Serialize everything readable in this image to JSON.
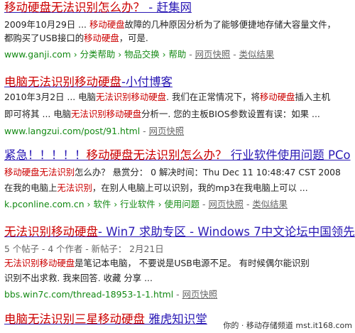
{
  "results": [
    {
      "title_pre": "移动硬盘无法识别怎么办？",
      "title_post": " - 赶集网",
      "snippet1_a": "2009年10月29日 ... ",
      "snippet1_b": "移动硬盘",
      "snippet1_c": "故障的几种原因分析为了能够便捷地存储大容量文件，",
      "snippet2": "都购买了USB接口的",
      "snippet2_b": "移动硬盘",
      "snippet2_c": "，可是.",
      "url": "www.ganji.com",
      "crumbs": [
        "分类帮助",
        "物品交换",
        "帮助"
      ],
      "cache": "网页快照",
      "similar": "类似结果"
    },
    {
      "title_pre": "电脑无法识别移动硬盘",
      "title_post": "-小付博客",
      "snippet1_a": "2010年3月2日 ... 电脑",
      "snippet1_b": "无法识别移动硬盘",
      "snippet1_c": ". 我们在正常情况下，将",
      "snippet1_d": "移动硬盘",
      "snippet1_e": "插入主机",
      "snippet2_a": "即可将其 ... 电脑",
      "snippet2_b": "无法识别移动硬盘",
      "snippet2_c": "分析一. 您的主板BIOS参数设置有误：如果 ...",
      "url": "www.langzui.com/post/91.html",
      "cache": "网页快照"
    },
    {
      "title_pre": "紧急！！！！！",
      "title_mid": "移动硬盘无法识别怎么办？",
      "title_post": " 行业软件使用问题 PCo",
      "snippet1_b": "移动硬盘无法识别",
      "snippet1_c": "怎么办？  悬赏分：  0 解决时间：Thu Dec 11 10:48:47 CST 2008",
      "snippet2_a": "在我的电脑上",
      "snippet2_b": "无法识别",
      "snippet2_c": "，在别人电脑上可以识别，我的mp3在我电脑上可以 ...",
      "url": "k.pconline.com.cn",
      "crumbs": [
        "软件",
        "行业软件",
        "使用问题"
      ],
      "cache": "网页快照",
      "similar": "类似结果"
    },
    {
      "title_pre": "无法识别移动硬盘",
      "title_post": "- Win7 求助专区 - Windows 7中文论坛中国领先的",
      "meta": "5 个帖子 - 4 个作者 - 新帖子： 2月21日",
      "snippet1_b": "无法识别移动硬盘",
      "snippet1_c": "是笔记本电脑， 不要说是USB电源不足。 有时候偶尔能识别",
      "snippet2": "识别不出求救. 我来回答. 收藏  分享 ...",
      "url": "bbs.win7c.com/thread-18953-1-1.html",
      "cache": "网页快照"
    },
    {
      "title_pre": "电脑无法识别三星移动硬盘",
      "title_post": " 雅虎知识堂"
    }
  ],
  "watermark": "你的 · 移动存储频道   mst.it168.com",
  "colors": {
    "title": "#2a19b5",
    "highlight": "#cc0000",
    "url": "#138913",
    "gray": "#666666"
  }
}
